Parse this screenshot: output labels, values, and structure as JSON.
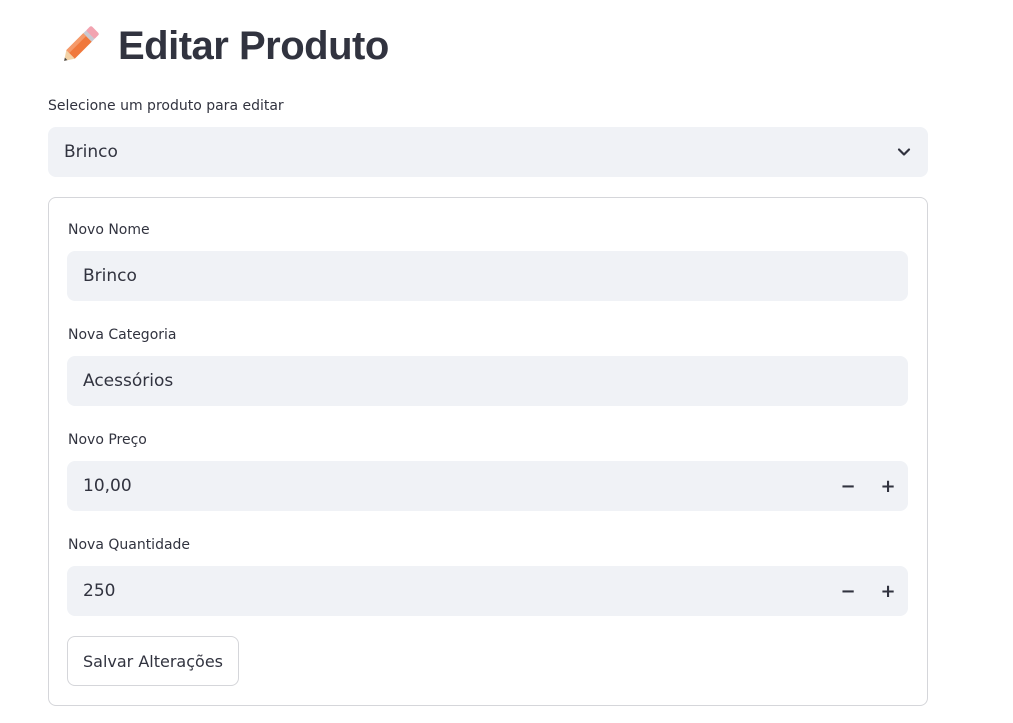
{
  "page": {
    "title": "Editar Produto",
    "title_icon": "pencil-icon"
  },
  "product_select": {
    "label": "Selecione um produto para editar",
    "selected": "Brinco",
    "icon": "chevron-down-icon"
  },
  "form": {
    "name_field": {
      "label": "Novo Nome",
      "value": "Brinco"
    },
    "category_field": {
      "label": "Nova Categoria",
      "value": "Acessórios"
    },
    "price_field": {
      "label": "Novo Preço",
      "value": "10,00",
      "decrement": "−",
      "increment": "+"
    },
    "quantity_field": {
      "label": "Nova Quantidade",
      "value": "250",
      "decrement": "−",
      "increment": "+"
    },
    "save_label": "Salvar Alterações"
  },
  "colors": {
    "input_bg": "#f0f2f6",
    "text": "#31333f",
    "border": "#d5d6da"
  }
}
